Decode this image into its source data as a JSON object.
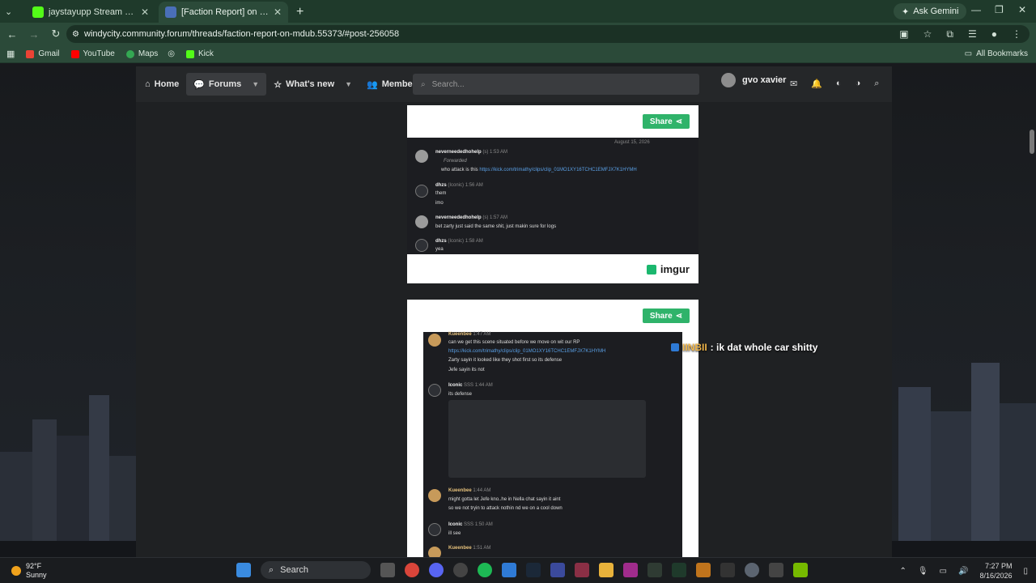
{
  "browser": {
    "tabs": [
      {
        "title": "jaystayupp Stream - Watch Live",
        "fav_color": "#53fc18"
      },
      {
        "title": "[Faction Report] on Mdub | Win",
        "fav_color": "#4a6fb8"
      }
    ],
    "new_tab": "+",
    "gemini": "Ask Gemini",
    "url": "windycity.community.forum/threads/faction-report-on-mdub.55373/#post-256058",
    "bookmarks": [
      "Gmail",
      "YouTube",
      "Maps",
      "Kick"
    ],
    "bookmark_colors": [
      "#ea4335",
      "#ff0000",
      "#34a853",
      "#53fc18"
    ],
    "all_bookmarks": "All Bookmarks"
  },
  "forum_nav": {
    "home": "Home",
    "forums": "Forums",
    "whats_new": "What's new",
    "members": "Members",
    "search_placeholder": "Search...",
    "username": "gvo xavier"
  },
  "posts": [
    {
      "share": "Share",
      "date": "August 15, 2026",
      "messages": [
        {
          "name": "neverneededhohelp",
          "tag": "(s)",
          "time": "1:53 AM",
          "forward": "Forwarded",
          "text": "who attack is this",
          "link": "https://kick.com/trimathy/clips/clip_01MO1XY16TCHC1EMFJX7K1HYMH"
        },
        {
          "name": "dhzs",
          "tag": "(Iconic)",
          "time": "1:56 AM",
          "text": "them",
          "text2": "imo"
        },
        {
          "name": "neverneededhohelp",
          "tag": "(s)",
          "time": "1:57 AM",
          "text": "bet zarty just said the same shit, just makin sure for logs"
        },
        {
          "name": "dhzs",
          "tag": "(Iconic)",
          "time": "1:58 AM",
          "text": "yea"
        }
      ],
      "imgur": "imgur"
    },
    {
      "share": "Share",
      "messages": [
        {
          "name": "Kueenbee",
          "time": "1:47 AM",
          "text": "can we get this scene situated before we move on wit our RP",
          "link": "https://kick.com/trimathy/clips/clip_01MO1XY16TCHC1EMFJX7K1HYMH",
          "text2": "Zarty sayin it looked like they shot first so its defense",
          "text3": "Jefe sayin its not"
        },
        {
          "name": "Iconic",
          "tag": "SSS",
          "time": "1:44 AM",
          "text": "its defense"
        },
        {
          "name": "Kueenbee",
          "time": "1:44 AM",
          "text": "might gotta let Jefe kno..he in Nella chat sayin it aint",
          "text2": "so we not tryin to attack nothin nd we on a cool down"
        },
        {
          "name": "Iconic",
          "tag": "SSS",
          "time": "1:50 AM",
          "text": "ill see"
        },
        {
          "name": "Kueenbee",
          "time": "1:51 AM"
        }
      ]
    }
  ],
  "stream_chat": {
    "user": "IINBII",
    "message": " : ik dat whole car shitty"
  },
  "taskbar": {
    "temp": "92°F",
    "condition": "Sunny",
    "search": "Search",
    "time": "7:27 PM",
    "date": "8/16/2026"
  }
}
